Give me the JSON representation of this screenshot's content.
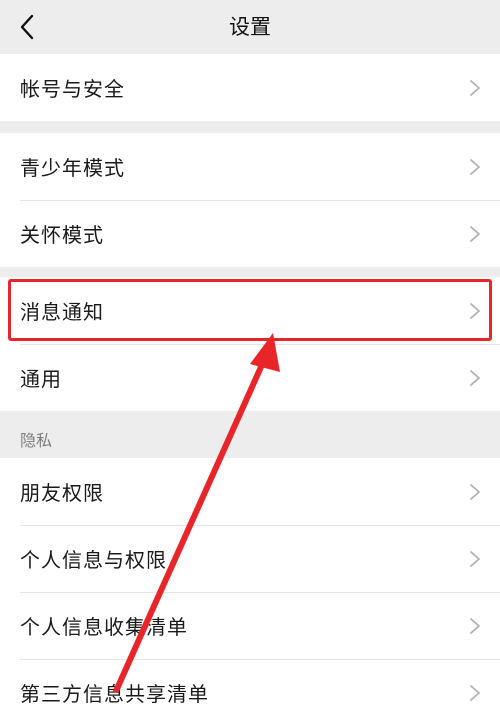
{
  "header": {
    "title": "设置",
    "back_icon": "chevron-left-icon"
  },
  "groups": [
    {
      "items": [
        {
          "label": "帐号与安全"
        }
      ]
    },
    {
      "items": [
        {
          "label": "青少年模式"
        },
        {
          "label": "关怀模式"
        }
      ]
    },
    {
      "items": [
        {
          "label": "消息通知",
          "highlighted": true
        },
        {
          "label": "通用"
        }
      ]
    },
    {
      "section_title": "隐私",
      "items": [
        {
          "label": "朋友权限"
        },
        {
          "label": "个人信息与权限"
        },
        {
          "label": "个人信息收集清单"
        },
        {
          "label": "第三方信息共享清单"
        }
      ]
    }
  ],
  "annotation": {
    "color": "#e8262a",
    "shape": "rectangle-and-arrow"
  },
  "colors": {
    "background": "#ededed",
    "row_background": "#ffffff",
    "divider": "#e5e5e5",
    "chevron": "#b2b2b2"
  }
}
